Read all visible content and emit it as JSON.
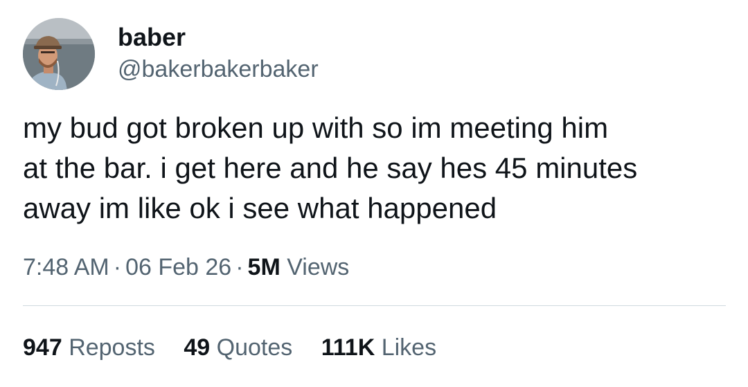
{
  "author": {
    "display_name": "baber",
    "handle": "@bakerbakerbaker"
  },
  "tweet": {
    "text_lines": [
      "my bud got broken up with so im meeting him",
      "at the bar. i get here and he say hes 45 minutes",
      "away im like ok i see what happened"
    ]
  },
  "meta": {
    "time": "7:48 AM",
    "separator": "·",
    "date": "06 Feb 26",
    "views_count": "5M",
    "views_label": "Views"
  },
  "stats": [
    {
      "count": "947",
      "label": "Reposts"
    },
    {
      "count": "49",
      "label": "Quotes"
    },
    {
      "count": "111K",
      "label": "Likes"
    }
  ],
  "colors": {
    "text_primary": "#0f1419",
    "text_secondary": "#536471",
    "divider": "#cfd9de"
  }
}
